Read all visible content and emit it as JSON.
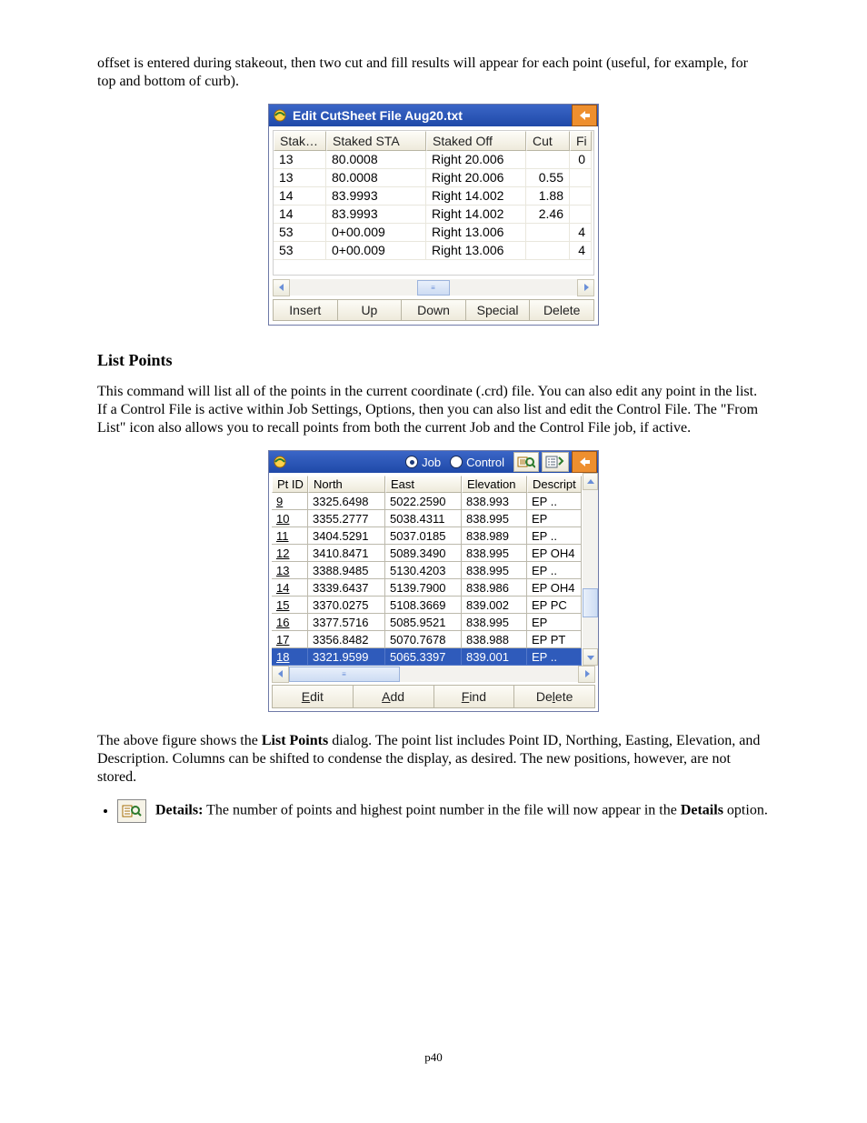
{
  "paragraphs": {
    "intro": "offset is entered during stakeout, then two cut and fill results will appear for each point (useful, for example, for top and bottom of curb).",
    "list_points_heading": "List Points",
    "list_points_body": "This command will list all of the points in the current coordinate (.crd) file.  You can also edit any point in the list. If a Control File is active within Job Settings, Options, then you can also list and edit the Control File.  The \"From List\" icon also allows you to recall points from both the current Job and the Control File job, if active.",
    "list_points_caption_1": "The above figure shows the ",
    "list_points_caption_bold": "List Points",
    "list_points_caption_2": " dialog. The point list includes Point ID, Northing, Easting, Elevation, and Description. Columns can be shifted to condense the display, as desired.  The new positions, however, are not stored.",
    "details_label": "Details:",
    "details_body_1": " The number of points and highest point number in the file will now appear in the ",
    "details_body_bold": "Details",
    "details_body_2": " option."
  },
  "dialog1": {
    "title": "Edit CutSheet File  Aug20.txt",
    "headers": {
      "stak": "Stak…",
      "sta": "Staked STA",
      "off": "Staked Off",
      "cut": "Cut",
      "fi": "Fi"
    },
    "rows": [
      {
        "stak": "13",
        "sta": "80.0008",
        "off": "Right 20.006",
        "cut": "",
        "fi": "0"
      },
      {
        "stak": "13",
        "sta": "80.0008",
        "off": "Right 20.006",
        "cut": "0.55",
        "fi": ""
      },
      {
        "stak": "14",
        "sta": "83.9993",
        "off": "Right 14.002",
        "cut": "1.88",
        "fi": ""
      },
      {
        "stak": "14",
        "sta": "83.9993",
        "off": "Right 14.002",
        "cut": "2.46",
        "fi": ""
      },
      {
        "stak": "53",
        "sta": "0+00.009",
        "off": "Right 13.006",
        "cut": "",
        "fi": "4"
      },
      {
        "stak": "53",
        "sta": "0+00.009",
        "off": "Right 13.006",
        "cut": "",
        "fi": "4"
      }
    ],
    "buttons": {
      "insert": "Insert",
      "up": "Up",
      "down": "Down",
      "special": "Special",
      "delete": "Delete"
    }
  },
  "dialog2": {
    "radios": {
      "job": "Job",
      "control": "Control"
    },
    "headers": {
      "pt": "Pt ID",
      "n": "North",
      "e": "East",
      "el": "Elevation",
      "de": "Descript"
    },
    "rows": [
      {
        "pt": "9",
        "n": "3325.6498",
        "e": "5022.2590",
        "el": "838.993",
        "de": "EP .."
      },
      {
        "pt": "10",
        "n": "3355.2777",
        "e": "5038.4311",
        "el": "838.995",
        "de": "EP"
      },
      {
        "pt": "11",
        "n": "3404.5291",
        "e": "5037.0185",
        "el": "838.989",
        "de": "EP .."
      },
      {
        "pt": "12",
        "n": "3410.8471",
        "e": "5089.3490",
        "el": "838.995",
        "de": "EP OH4"
      },
      {
        "pt": "13",
        "n": "3388.9485",
        "e": "5130.4203",
        "el": "838.995",
        "de": "EP .."
      },
      {
        "pt": "14",
        "n": "3339.6437",
        "e": "5139.7900",
        "el": "838.986",
        "de": "EP OH4"
      },
      {
        "pt": "15",
        "n": "3370.0275",
        "e": "5108.3669",
        "el": "839.002",
        "de": "EP PC"
      },
      {
        "pt": "16",
        "n": "3377.5716",
        "e": "5085.9521",
        "el": "838.995",
        "de": "EP"
      },
      {
        "pt": "17",
        "n": "3356.8482",
        "e": "5070.7678",
        "el": "838.988",
        "de": "EP PT"
      },
      {
        "pt": "18",
        "n": "3321.9599",
        "e": "5065.3397",
        "el": "839.001",
        "de": "EP .."
      }
    ],
    "selected_index": 9,
    "buttons": {
      "edit": "Edit",
      "add": "Add",
      "find": "Find",
      "delete": "Delete"
    }
  },
  "page_number": "p40"
}
